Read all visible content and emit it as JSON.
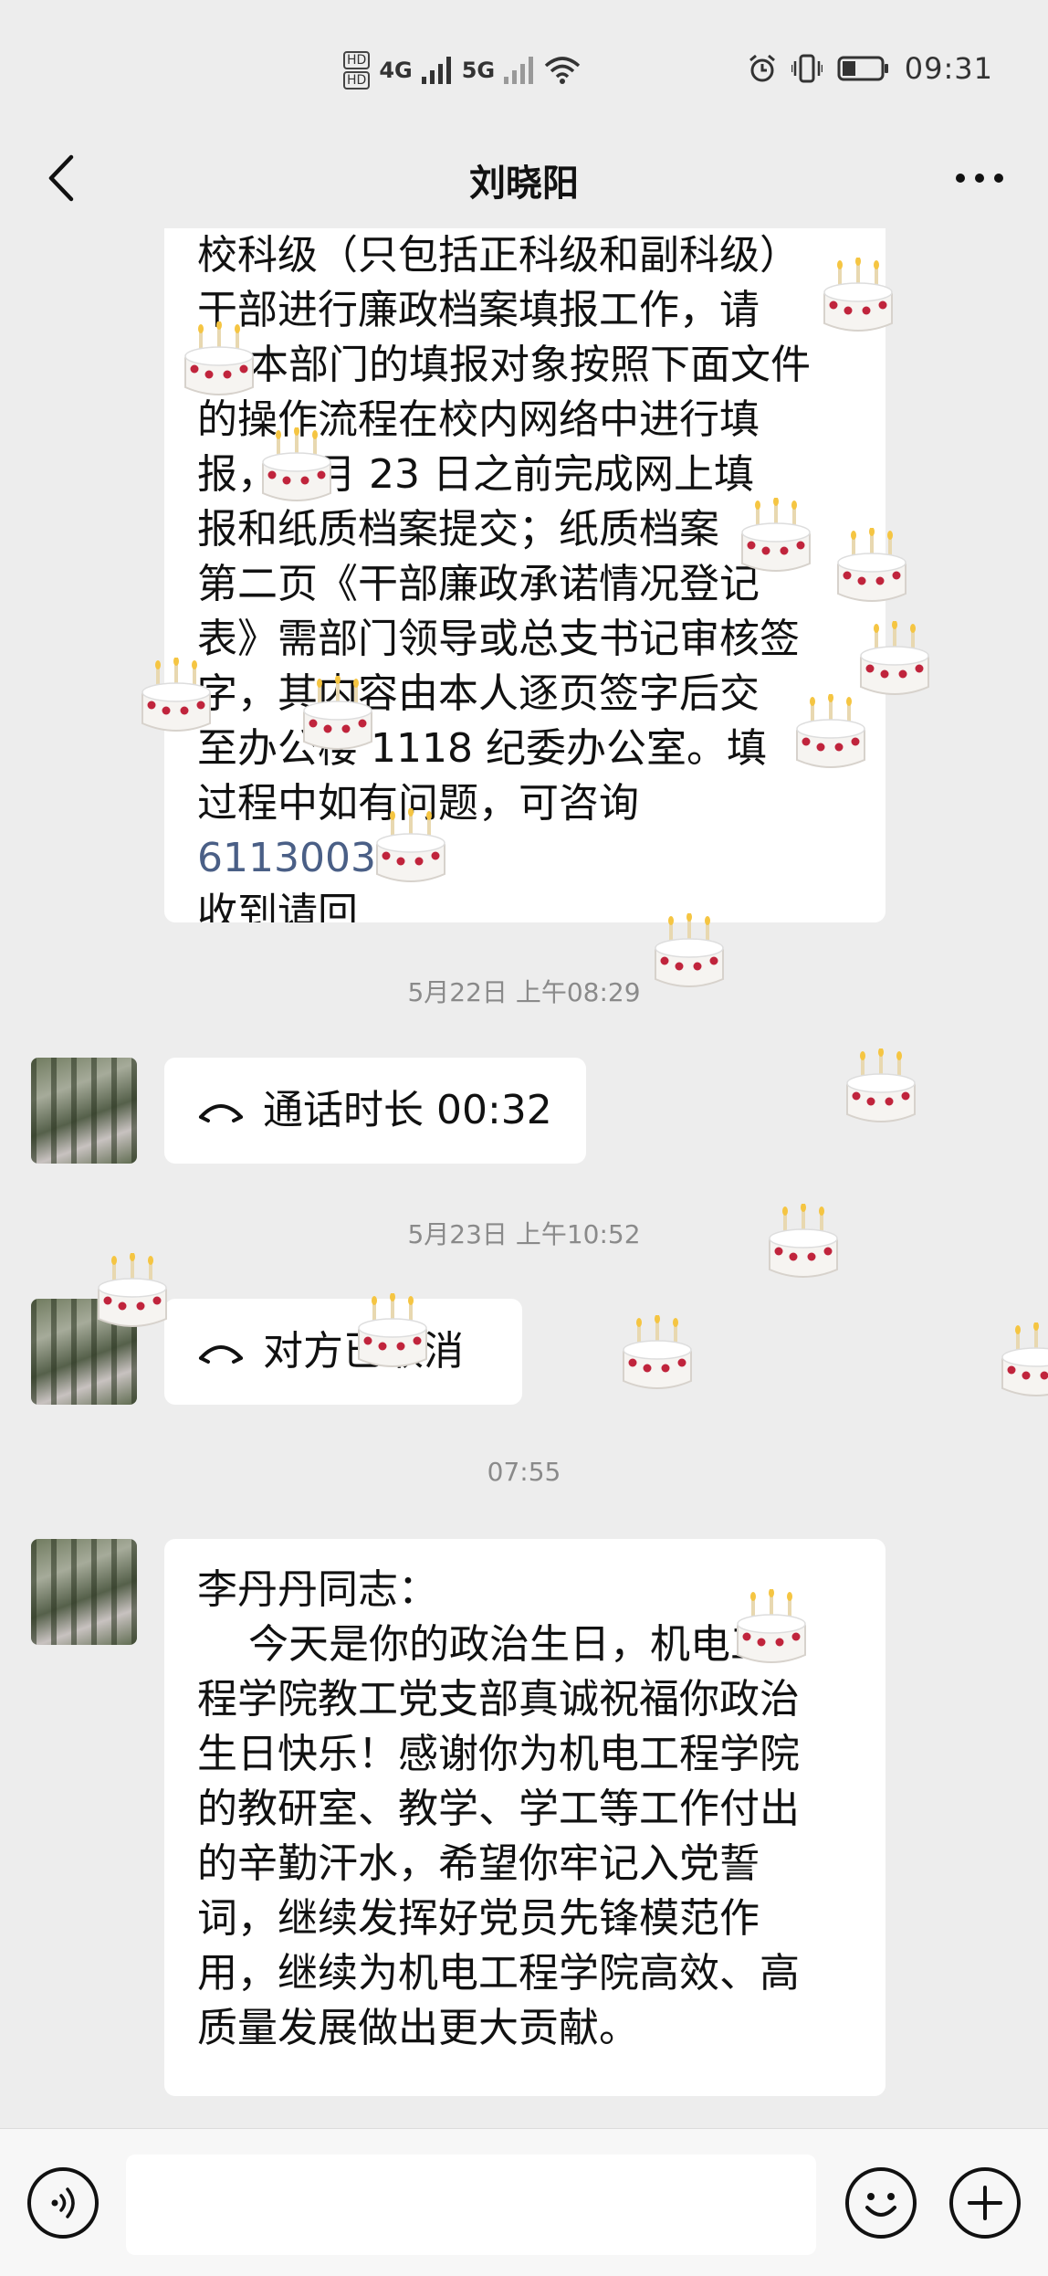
{
  "status_bar": {
    "hd1": "HD",
    "hd2": "HD",
    "net1": "4G",
    "net2": "5G",
    "time": "09:31"
  },
  "header": {
    "title": "刘晓阳",
    "back_icon": "chevron-left-icon",
    "more_icon": "more-horizontal-icon"
  },
  "messages": {
    "first": {
      "line1": "校科级（只包括正科级和副科级）",
      "line2": "干部进行廉政档案填报工作，请",
      "line3": "本部门的填报对象按照下面文件",
      "line4": "的操作流程在校内网络中进行填",
      "line5": "报，5 月 23 日之前完成网上填",
      "line6": "报和纸质档案提交；纸质档案",
      "line7": "第二页《干部廉政承诺情况登记",
      "line8": "表》需部门领导或总支书记审核签",
      "line9": "字，其",
      "line9b": "内容由本人逐页签字后交",
      "line10": "至办公楼 1118 纪委办公室。填",
      "line11_pre": "过程中如有问题，可咨询 ",
      "line11_phone": "61130032",
      "line11_post": "。",
      "line12": "收到请回"
    },
    "ts1": "5月22日 上午08:29",
    "call1": "通话时长 00:32",
    "ts2": "5月23日 上午10:52",
    "call2": "对方已取消",
    "ts3": "07:55",
    "last": {
      "text": "李丹丹同志：\n    今天是你的政治生日，机电工\n程学院教工党支部真诚祝福你政治\n生日快乐！感谢你为机电工程学院\n的教研室、教学、学工等工作付出\n的辛勤汗水，希望你牢记入党誓\n词，继续发挥好党员先锋模范作\n用，继续为机电工程学院高效、高\n质量发展做出更大贡献。"
    }
  },
  "bottom_bar": {
    "voice_icon": "voice-icon",
    "emoji_icon": "emoji-icon",
    "plus_icon": "plus-icon",
    "input_placeholder": ""
  },
  "overlay": {
    "effect_icon": "birthday-cake-icon"
  }
}
